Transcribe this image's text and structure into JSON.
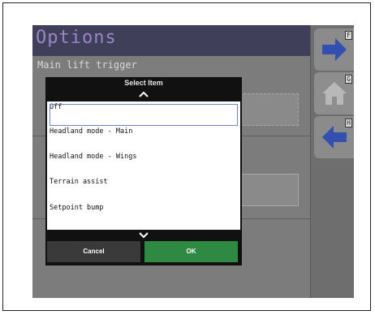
{
  "screen": {
    "title": "Options",
    "option_label": "Main lift trigger"
  },
  "sidebar": {
    "buttons": [
      {
        "icon": "arrow-right-icon",
        "key": "F",
        "color": "#3350b0"
      },
      {
        "icon": "home-icon",
        "key": "G",
        "color": "#b8b8b8"
      },
      {
        "icon": "arrow-left-icon",
        "key": "H",
        "color": "#3350b0"
      }
    ]
  },
  "dialog": {
    "title": "Select Item",
    "scroll_up_icon": "chevron-up-icon",
    "scroll_down_icon": "chevron-down-icon",
    "items": [
      {
        "label": "Off",
        "selected": true
      },
      {
        "label": "Headland mode - Main",
        "selected": false
      },
      {
        "label": "Headland mode - Wings",
        "selected": false
      },
      {
        "label": "Terrain assist",
        "selected": false
      },
      {
        "label": "Setpoint bump",
        "selected": false
      }
    ],
    "cancel_label": "Cancel",
    "ok_label": "OK",
    "ok_color": "#2e8a42"
  }
}
